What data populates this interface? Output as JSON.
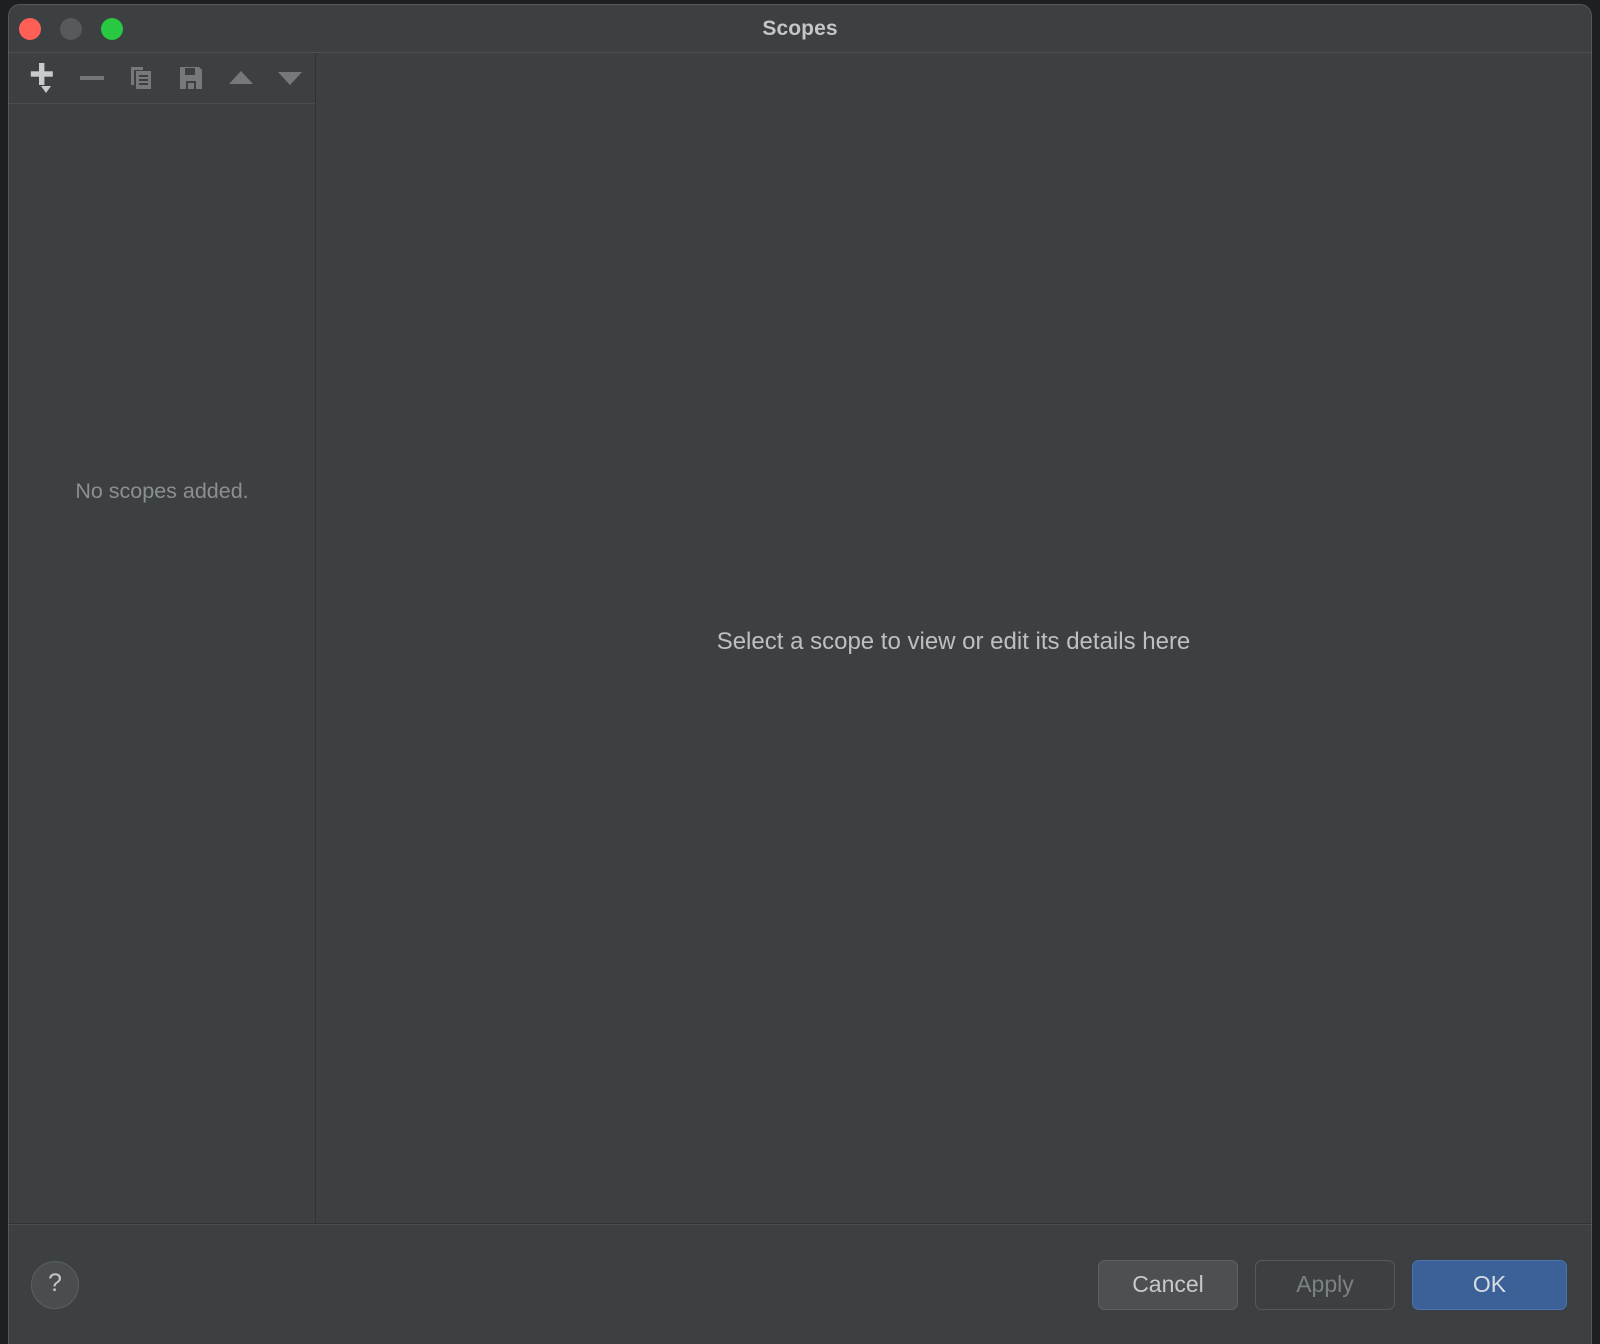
{
  "window": {
    "title": "Scopes",
    "traffic_lights": [
      {
        "name": "close",
        "color": "#ff5f57"
      },
      {
        "name": "minimize",
        "color": "#57595b"
      },
      {
        "name": "zoom",
        "color": "#28c840"
      }
    ]
  },
  "sidebar": {
    "toolbar": [
      {
        "icon": "add-icon",
        "label": "Add scope"
      },
      {
        "icon": "remove-icon",
        "label": "Remove scope"
      },
      {
        "icon": "duplicate-icon",
        "label": "Duplicate scope"
      },
      {
        "icon": "save-icon",
        "label": "Save scope"
      },
      {
        "icon": "move-up-icon",
        "label": "Move up"
      },
      {
        "icon": "move-down-icon",
        "label": "Move down"
      }
    ],
    "empty_message": "No scopes added."
  },
  "detail": {
    "placeholder": "Select a scope to view or edit its details here"
  },
  "footer": {
    "help_label": "?",
    "buttons": [
      {
        "name": "cancel",
        "label": "Cancel",
        "style": "secondary",
        "enabled": true
      },
      {
        "name": "apply",
        "label": "Apply",
        "style": "disabled",
        "enabled": false
      },
      {
        "name": "ok",
        "label": "OK",
        "style": "primary",
        "enabled": true
      }
    ]
  },
  "colors": {
    "window_background": "#3c4042",
    "accent_primary": "#3c6198",
    "text_primary": "#c3c6c8",
    "text_muted": "#8b8f91"
  }
}
